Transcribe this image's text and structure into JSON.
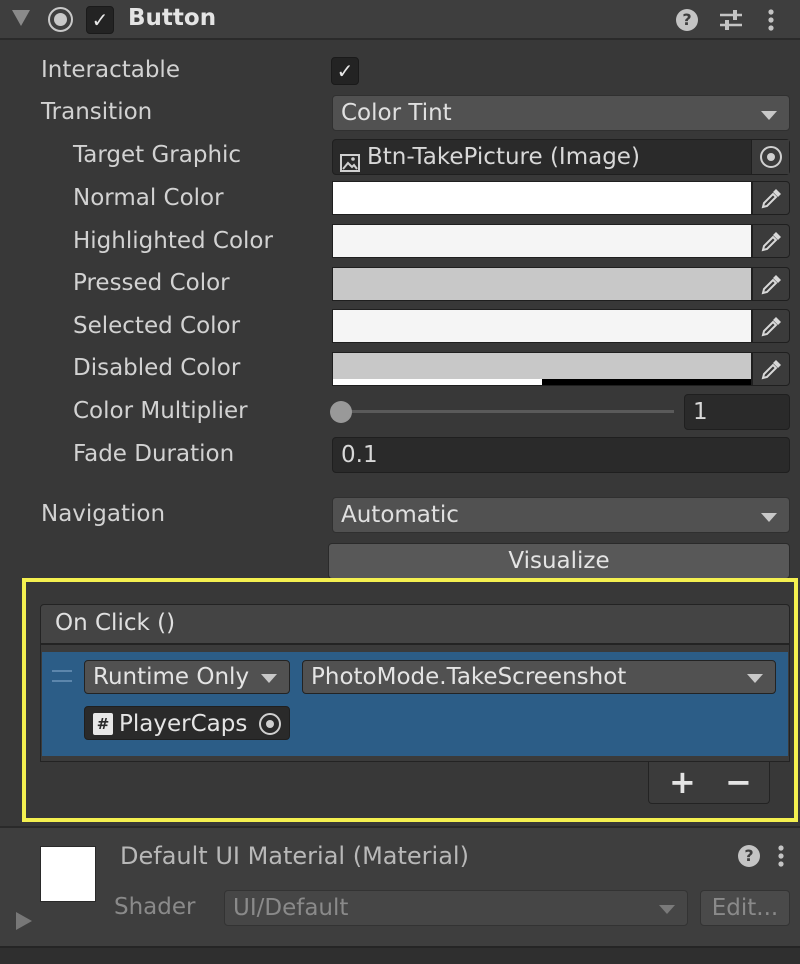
{
  "component": {
    "title": "Button",
    "enabled": true
  },
  "properties": {
    "interactable_label": "Interactable",
    "interactable_checked": true,
    "transition_label": "Transition",
    "transition_value": "Color Tint",
    "target_graphic_label": "Target Graphic",
    "target_graphic_value": "Btn-TakePicture (Image)",
    "normal_color_label": "Normal Color",
    "normal_color": "#ffffff",
    "highlighted_color_label": "Highlighted Color",
    "highlighted_color": "#f5f5f5",
    "pressed_color_label": "Pressed Color",
    "pressed_color": "#c8c8c8",
    "selected_color_label": "Selected Color",
    "selected_color": "#f5f5f5",
    "disabled_color_label": "Disabled Color",
    "disabled_color": "#c8c8c8",
    "disabled_alpha": 0.5,
    "color_multiplier_label": "Color Multiplier",
    "color_multiplier_value": "1",
    "color_multiplier_slider_fraction": 0,
    "fade_duration_label": "Fade Duration",
    "fade_duration_value": "0.1",
    "navigation_label": "Navigation",
    "navigation_value": "Automatic",
    "visualize_label": "Visualize"
  },
  "on_click": {
    "header": "On Click ()",
    "runtime_value": "Runtime Only",
    "function_value": "PhotoMode.TakeScreenshot",
    "object_value": "PlayerCaps",
    "plus_label": "+",
    "minus_label": "−"
  },
  "material": {
    "title": "Default UI Material (Material)",
    "shader_label": "Shader",
    "shader_value": "UI/Default",
    "edit_label": "Edit..."
  },
  "icons": [
    "foldout-arrow-icon",
    "radio-icon",
    "check-icon",
    "help-icon",
    "settings-sliders-icon",
    "more-vert-icon",
    "image-icon",
    "target-icon",
    "eyedropper-icon",
    "script-hash-icon",
    "play-icon"
  ]
}
